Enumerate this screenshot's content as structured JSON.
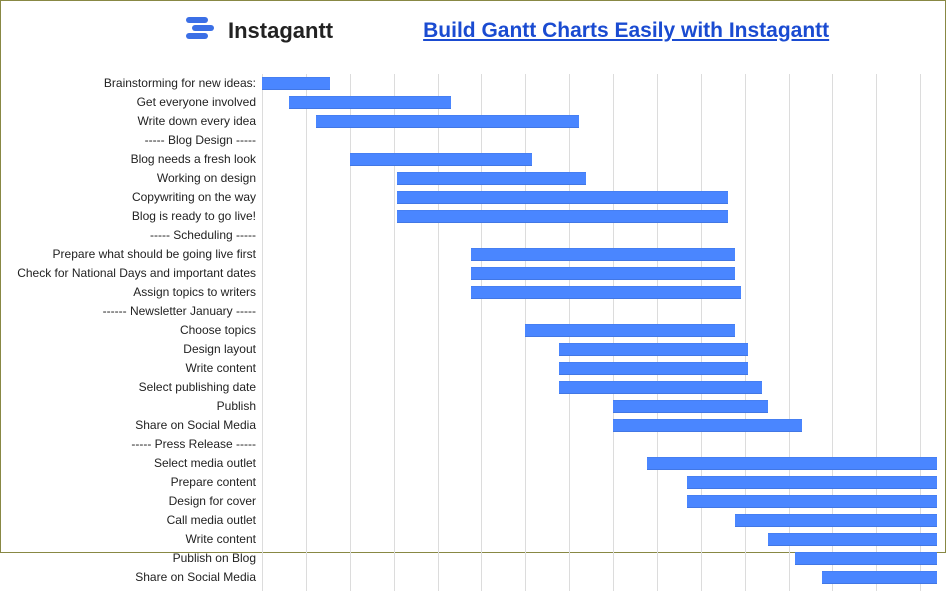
{
  "header": {
    "brand_name": "Instagantt",
    "title_link": "Build Gantt Charts Easily with Instagantt"
  },
  "colors": {
    "accent": "#4a86ff",
    "link": "#1a4bd1",
    "grid": "#dcdcdc"
  },
  "chart_data": {
    "type": "bar",
    "title": "Build Gantt Charts Easily with Instagantt",
    "xlabel": "",
    "ylabel": "",
    "xlim": [
      0,
      100
    ],
    "categories": [
      "Brainstorming for new ideas:",
      "Get everyone involved",
      "Write down every idea",
      "----- Blog Design -----",
      "Blog needs a fresh look",
      "Working on design",
      "Copywriting on the way",
      "Blog is ready to go live!",
      "----- Scheduling -----",
      "Prepare what should be going live first",
      "Check for National Days and important dates",
      "Assign topics to writers",
      "------ Newsletter January -----",
      "Choose topics",
      "Design layout",
      "Write content",
      "Select publishing date",
      "Publish",
      "Share on Social Media",
      "----- Press Release -----",
      "Select media outlet",
      "Prepare content",
      "Design for cover",
      "Call media outlet",
      "Write content",
      "Publish on Blog",
      "Share on Social Media"
    ],
    "tasks": [
      {
        "label": "Brainstorming for new ideas:",
        "start": 0,
        "end": 10
      },
      {
        "label": "Get everyone involved",
        "start": 4,
        "end": 28
      },
      {
        "label": "Write down every idea",
        "start": 8,
        "end": 47
      },
      {
        "label": "----- Blog Design -----",
        "start": null,
        "end": null
      },
      {
        "label": "Blog needs a fresh look",
        "start": 13,
        "end": 40
      },
      {
        "label": "Working on design",
        "start": 20,
        "end": 48
      },
      {
        "label": "Copywriting on the way",
        "start": 20,
        "end": 69
      },
      {
        "label": "Blog is ready to go live!",
        "start": 20,
        "end": 69
      },
      {
        "label": "----- Scheduling -----",
        "start": null,
        "end": null
      },
      {
        "label": "Prepare what should be going live first",
        "start": 31,
        "end": 70
      },
      {
        "label": "Check for National Days and important dates",
        "start": 31,
        "end": 70
      },
      {
        "label": "Assign topics to writers",
        "start": 31,
        "end": 71
      },
      {
        "label": "------ Newsletter January -----",
        "start": null,
        "end": null
      },
      {
        "label": "Choose topics",
        "start": 39,
        "end": 70
      },
      {
        "label": "Design layout",
        "start": 44,
        "end": 72
      },
      {
        "label": "Write content",
        "start": 44,
        "end": 72
      },
      {
        "label": "Select publishing date",
        "start": 44,
        "end": 74
      },
      {
        "label": "Publish",
        "start": 52,
        "end": 75
      },
      {
        "label": "Share on Social Media",
        "start": 52,
        "end": 80
      },
      {
        "label": "----- Press Release -----",
        "start": null,
        "end": null
      },
      {
        "label": "Select media outlet",
        "start": 57,
        "end": 100
      },
      {
        "label": "Prepare content",
        "start": 63,
        "end": 100
      },
      {
        "label": "Design for cover",
        "start": 63,
        "end": 100
      },
      {
        "label": "Call media outlet",
        "start": 70,
        "end": 100
      },
      {
        "label": "Write content",
        "start": 75,
        "end": 100
      },
      {
        "label": "Publish on Blog",
        "start": 79,
        "end": 100
      },
      {
        "label": "Share on Social Media",
        "start": 83,
        "end": 100
      }
    ],
    "gridlines_percent": [
      0,
      6.5,
      13,
      19.5,
      26,
      32.5,
      39,
      45.5,
      52,
      58.5,
      65,
      71.5,
      78,
      84.5,
      91,
      97.5
    ]
  }
}
